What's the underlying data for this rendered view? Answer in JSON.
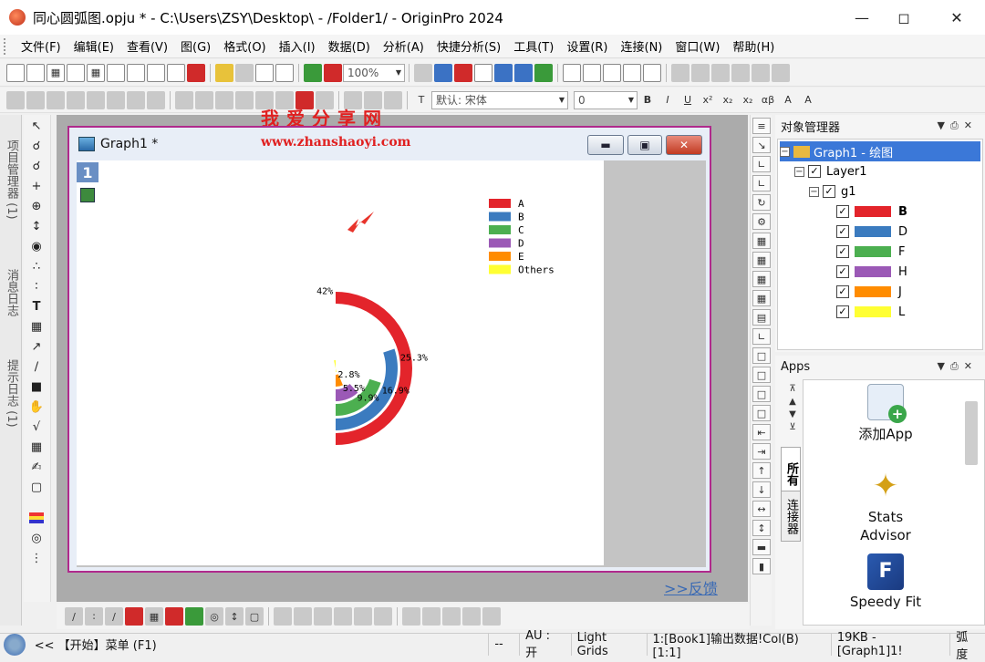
{
  "window": {
    "title": "同心圆弧图.opju * - C:\\Users\\ZSY\\Desktop\\ - /Folder1/ - OriginPro 2024"
  },
  "menu": [
    "文件(F)",
    "编辑(E)",
    "查看(V)",
    "图(G)",
    "格式(O)",
    "插入(I)",
    "数据(D)",
    "分析(A)",
    "快捷分析(S)",
    "工具(T)",
    "设置(R)",
    "连接(N)",
    "窗口(W)",
    "帮助(H)"
  ],
  "toolbar": {
    "zoom": "100%",
    "font_placeholder": "默认: 宋体",
    "font_size": "0"
  },
  "left_tabs": [
    "项目管理器 (1)",
    "消息日志",
    "提示日志 (1)"
  ],
  "graph_window": {
    "title": "Graph1 *",
    "layer": "1"
  },
  "watermark": {
    "line1": "我爱分享网",
    "line2": "www.zhanshaoyi.com"
  },
  "chart_data": {
    "type": "concentric-arc",
    "categories": [
      "A",
      "B",
      "C",
      "D",
      "E",
      "Others"
    ],
    "values": [
      42,
      25.3,
      16.9,
      9.9,
      5.5,
      2.8
    ],
    "labels": [
      "42%",
      "25.3%",
      "16.9%",
      "9.9%",
      "5.5%",
      "2.8%"
    ],
    "colors": [
      "#e3242b",
      "#3b7bbf",
      "#4caf50",
      "#9b59b6",
      "#ff8c00",
      "#ffff33"
    ],
    "legend_position": "top-right"
  },
  "object_manager": {
    "title": "对象管理器",
    "graph": "Graph1 - 绘图",
    "layer": "Layer1",
    "group": "g1",
    "plots": [
      {
        "name": "B",
        "color": "#e3242b"
      },
      {
        "name": "D",
        "color": "#3b7bbf"
      },
      {
        "name": "F",
        "color": "#4caf50"
      },
      {
        "name": "H",
        "color": "#9b59b6"
      },
      {
        "name": "J",
        "color": "#ff8c00"
      },
      {
        "name": "L",
        "color": "#ffff33"
      }
    ]
  },
  "apps": {
    "title": "Apps",
    "tab_all": "所有",
    "tab_connector": "连接器",
    "items": [
      "添加App",
      "Stats Advisor",
      "Speedy Fit"
    ]
  },
  "feedback": ">>反馈",
  "status": [
    "<< 【开始】菜单 (F1)",
    "--",
    "AU : 开",
    "Light Grids",
    "1:[Book1]输出数据!Col(B)[1:1]",
    "19KB - [Graph1]1!",
    "弧度"
  ]
}
